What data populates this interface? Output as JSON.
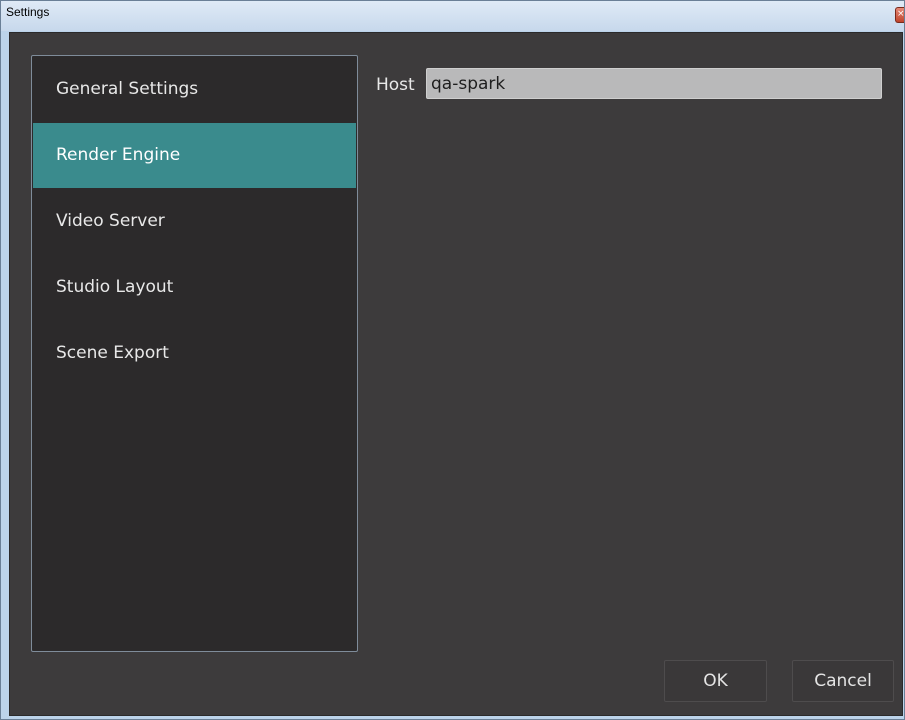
{
  "window": {
    "title": "Settings",
    "close_glyph": "×"
  },
  "sidebar": {
    "selected_index": 1,
    "items": [
      {
        "label": "General Settings"
      },
      {
        "label": "Render Engine"
      },
      {
        "label": "Video Server"
      },
      {
        "label": "Studio Layout"
      },
      {
        "label": "Scene Export"
      }
    ]
  },
  "render_engine": {
    "host_label": "Host",
    "host_value": "qa-spark"
  },
  "buttons": {
    "ok_label": "OK",
    "cancel_label": "Cancel"
  },
  "colors": {
    "background": "#3d3b3c",
    "sidebar_background": "#2c2a2b",
    "selected_item": "#3a8b8d",
    "input_background": "#b9b9ba",
    "titlebar": "#c7d8ec",
    "close_button": "#c0442b"
  }
}
